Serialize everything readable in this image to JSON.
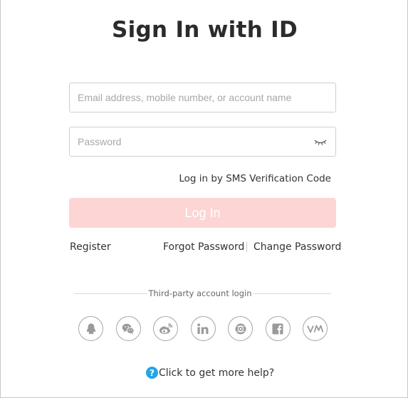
{
  "title": "Sign In with ID",
  "email": {
    "placeholder": "Email address, mobile number, or account name",
    "value": ""
  },
  "password": {
    "placeholder": "Password",
    "value": "",
    "toggle_icon": "eye-closed-icon"
  },
  "sms_link": "Log in by SMS Verification Code",
  "login_button": "Log In",
  "login_button_color": "#fdd5d5",
  "links": {
    "register": "Register",
    "forgot_password": "Forgot Password",
    "change_password": "Change Password"
  },
  "third_party": {
    "label": "Third-party account login",
    "providers": [
      {
        "icon": "qq-icon"
      },
      {
        "icon": "wechat-icon"
      },
      {
        "icon": "weibo-icon"
      },
      {
        "icon": "linkedin-icon"
      },
      {
        "icon": "globe-icon"
      },
      {
        "icon": "facebook-icon"
      },
      {
        "icon": "vk-icon"
      }
    ]
  },
  "help": {
    "icon": "question-icon",
    "icon_glyph": "?",
    "text": "Click to get more help?",
    "icon_color": "#22a6e8"
  }
}
